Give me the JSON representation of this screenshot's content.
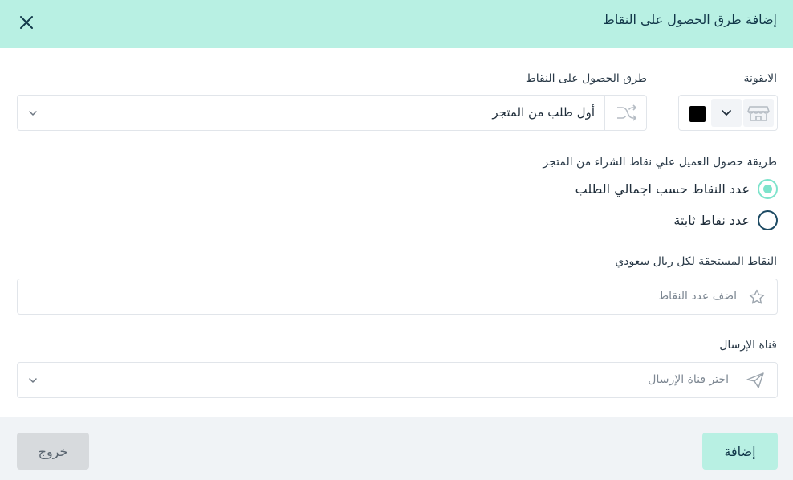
{
  "header": {
    "title": "إضافة طرق الحصول على النقاط",
    "close_icon": "close-icon"
  },
  "icon_field": {
    "label": "الايقونة",
    "selected_icon": "store-icon",
    "color": "#000000"
  },
  "method_field": {
    "label": "طرق الحصول على النقاط",
    "value": "أول طلب من المتجر",
    "icon": "share-icon"
  },
  "calc_method": {
    "label": "طريقة حصول العميل علي نقاط الشراء من المتجر",
    "options": [
      {
        "label": "عدد النقاط حسب اجمالي الطلب",
        "checked": true
      },
      {
        "label": "عدد نقاط ثابتة",
        "checked": false
      }
    ]
  },
  "points_field": {
    "label": "النقاط المستحقة لكل ريال سعودي",
    "placeholder": "اضف عدد النقاط",
    "icon": "star-icon"
  },
  "channel_field": {
    "label": "قناة الإرسال",
    "placeholder": "اختر قناة الإرسال",
    "icon": "send-icon"
  },
  "footer": {
    "add_label": "إضافة",
    "exit_label": "خروج"
  },
  "colors": {
    "header_bg": "#b8f0e3",
    "accent": "#7de3cb",
    "footer_bg": "#f0f3f6"
  }
}
